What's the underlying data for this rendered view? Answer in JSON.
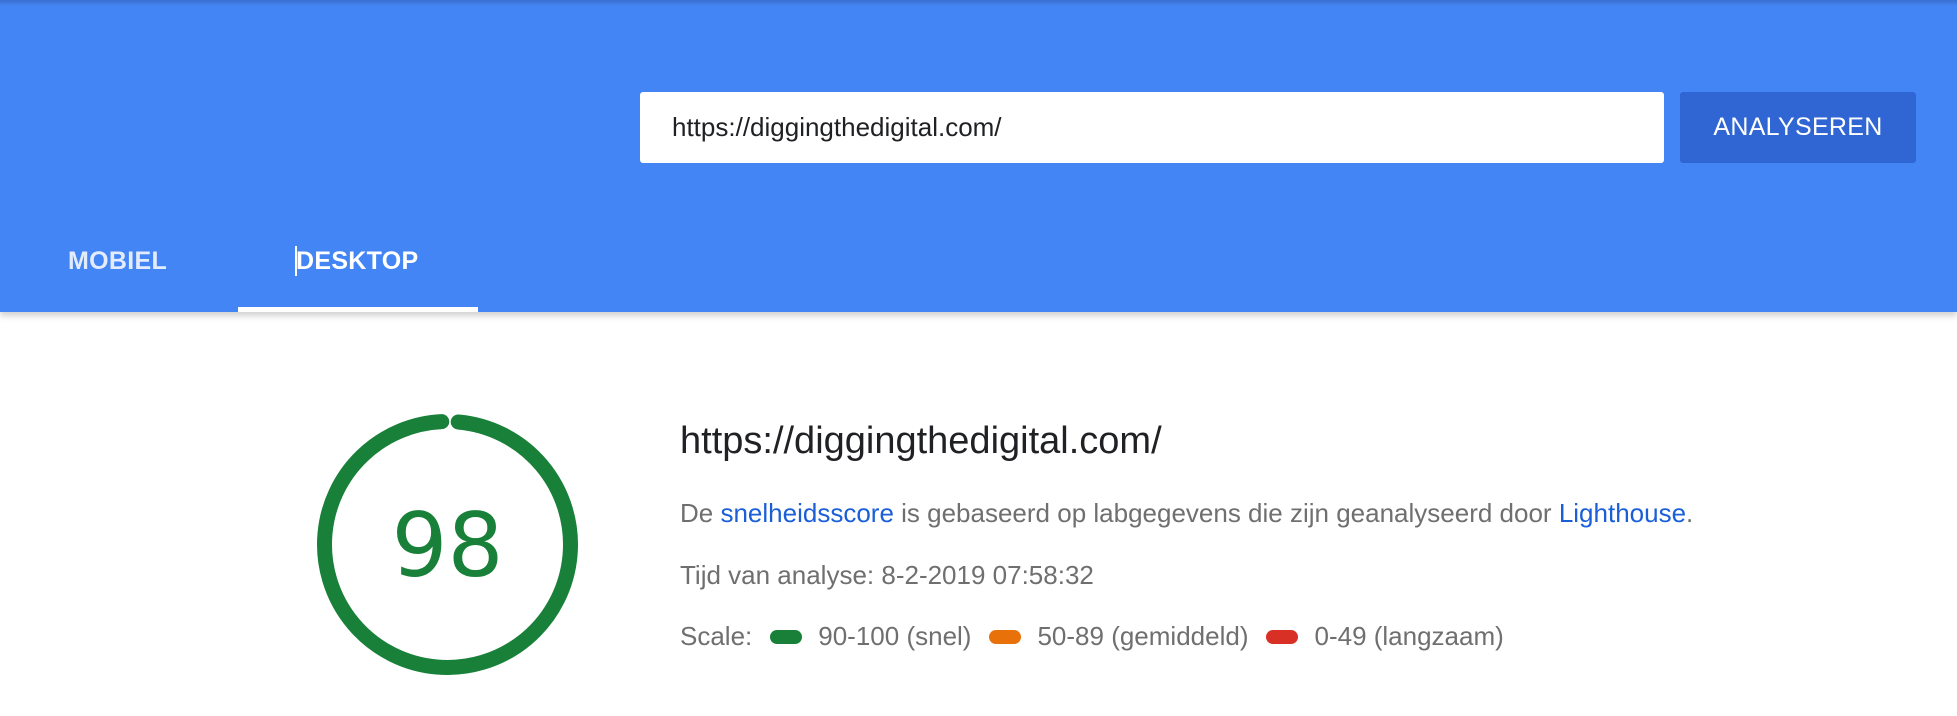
{
  "search": {
    "value": "https://diggingthedigital.com/",
    "button_label": "ANALYSEREN"
  },
  "tabs": [
    {
      "label": "MOBIEL",
      "selected": false
    },
    {
      "label": "DESKTOP",
      "selected": true
    }
  ],
  "result": {
    "score": "98",
    "url": "https://diggingthedigital.com/",
    "description": {
      "prefix": "De ",
      "link1": "snelheidsscore",
      "middle": " is gebaseerd op labgegevens die zijn geanalyseerd door ",
      "link2": "Lighthouse",
      "suffix": "."
    },
    "analysis_time": "Tijd van analyse: 8-2-2019 07:58:32",
    "scale": {
      "label": "Scale:",
      "ranges": [
        {
          "text": "90-100 (snel)",
          "color": "#188038"
        },
        {
          "text": "50-89 (gemiddeld)",
          "color": "#e8710a"
        },
        {
          "text": "0-49 (langzaam)",
          "color": "#d93025"
        }
      ]
    }
  },
  "colors": {
    "header": "#4485f5",
    "button": "#2f66d4",
    "score_green": "#188038",
    "link": "#1a5fd8"
  }
}
